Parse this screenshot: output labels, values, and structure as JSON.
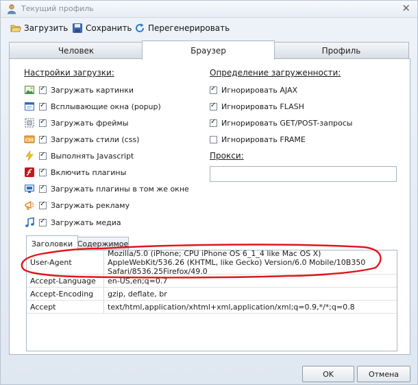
{
  "window": {
    "title": "Текущий профиль",
    "close_glyph": "✕"
  },
  "toolbar": {
    "load": "Загрузить",
    "save": "Сохранить",
    "regenerate": "Перегенерировать"
  },
  "tabs": [
    {
      "label": "Человек"
    },
    {
      "label": "Браузер",
      "active": true
    },
    {
      "label": "Профиль"
    }
  ],
  "load_settings": {
    "title": "Настройки загрузки:",
    "items": [
      {
        "label": "Загружать картинки",
        "checked": true,
        "icon": "image-icon"
      },
      {
        "label": "Всплывающие окна (popup)",
        "checked": true,
        "icon": "popup-window-icon"
      },
      {
        "label": "Загружать фреймы",
        "checked": true,
        "icon": "frame-icon"
      },
      {
        "label": "Загружать стили (css)",
        "checked": true,
        "icon": "css-icon"
      },
      {
        "label": "Выполнять Javascript",
        "checked": true,
        "icon": "lightning-icon"
      },
      {
        "label": "Включить плагины",
        "checked": true,
        "icon": "flash-plugin-icon"
      },
      {
        "label": "Загружать плагины в том же окне",
        "checked": true,
        "icon": "plugin-window-icon"
      },
      {
        "label": "Загружать рекламу",
        "checked": true,
        "icon": "ad-megaphone-icon"
      },
      {
        "label": "Загружать медиа",
        "checked": true,
        "icon": "music-note-icon"
      }
    ]
  },
  "load_detection": {
    "title": "Определение загруженности:",
    "items": [
      {
        "label": "Игнорировать AJAX",
        "checked": true
      },
      {
        "label": "Игнорировать FLASH",
        "checked": true
      },
      {
        "label": "Игнорировать GET/POST-запросы",
        "checked": true
      },
      {
        "label": "Игнорировать FRAME",
        "checked": false
      }
    ]
  },
  "proxy": {
    "label": "Прокси:",
    "value": ""
  },
  "subtabs": [
    {
      "label": "Заголовки",
      "active": true
    },
    {
      "label": "Содержимое"
    }
  ],
  "headers": [
    {
      "name": "User-Agent",
      "value": "Mozilla/5.0 (iPhone; CPU iPhone OS 6_1_4 like Mac OS X) AppleWebKit/536.26 (KHTML, like Gecko) Version/6.0 Mobile/10B350 Safari/8536.25Firefox/49.0"
    },
    {
      "name": "Accept-Language",
      "value": "en-US,en;q=0.7"
    },
    {
      "name": "Accept-Encoding",
      "value": "gzip, deflate, br"
    },
    {
      "name": "Accept",
      "value": "text/html,application/xhtml+xml,application/xml;q=0.9,*/*;q=0.8"
    }
  ],
  "buttons": {
    "ok": "OK",
    "cancel": "Отмена"
  },
  "colors": {
    "annotation": "#e0141b",
    "accent": "#1f6fc0"
  }
}
